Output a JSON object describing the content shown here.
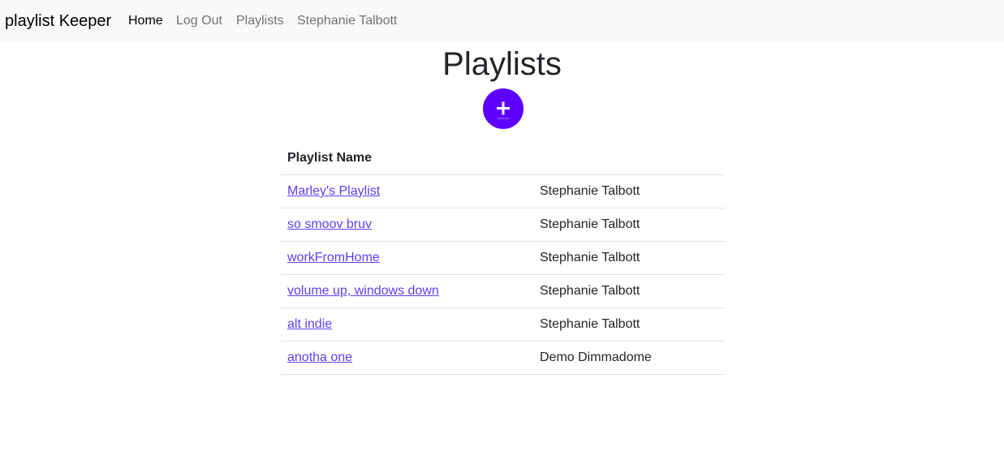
{
  "nav": {
    "brand": "playlist Keeper",
    "links": [
      "Home",
      "Log Out",
      "Playlists",
      "Stephanie Talbott"
    ]
  },
  "main": {
    "title": "Playlists",
    "add_button_icon": "plus-icon"
  },
  "table": {
    "headers": [
      "Playlist Name",
      ""
    ],
    "rows": [
      {
        "name": "Marley's Playlist",
        "owner": "Stephanie Talbott"
      },
      {
        "name": "so smoov bruv",
        "owner": "Stephanie Talbott"
      },
      {
        "name": "workFromHome",
        "owner": "Stephanie Talbott"
      },
      {
        "name": "volume up, windows down",
        "owner": "Stephanie Talbott"
      },
      {
        "name": "alt indie",
        "owner": "Stephanie Talbott"
      },
      {
        "name": "anotha one",
        "owner": "Demo Dimmadome"
      }
    ]
  },
  "colors": {
    "accent": "#5e00ff",
    "link": "#5b3ff0",
    "navbar_bg": "#f8f9fa"
  }
}
